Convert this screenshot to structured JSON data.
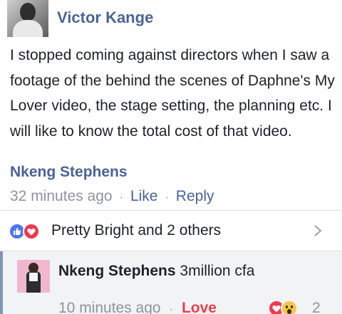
{
  "comment": {
    "author": "Victor Kange",
    "text": "I stopped coming against directors when I saw a footage of the behind the scenes of Daphne's My Lover video, the stage setting, the planning etc. I will like to know the total cost of that video.",
    "tagged_name": "Nkeng Stephens",
    "time": "32 minutes ago",
    "like_label": "Like",
    "reply_label": "Reply",
    "separator": "·"
  },
  "reactions": {
    "summary": "Pretty Bright and 2 others",
    "icons": [
      "like-icon",
      "love-icon"
    ],
    "colors": {
      "like": "#4e78e6",
      "love": "#f0394f"
    }
  },
  "reply": {
    "author": "Nkeng Stephens",
    "text": "3million cfa",
    "time": "10 minutes ago",
    "reaction_label": "Love",
    "reaction_count": "2",
    "icons": [
      "love-icon",
      "wow-icon"
    ],
    "separator": "·"
  },
  "colors": {
    "link_blue": "#4b6394",
    "meta_gray": "#8d949e",
    "love_red": "#e6414f",
    "reply_bg": "#f2f3f5"
  }
}
